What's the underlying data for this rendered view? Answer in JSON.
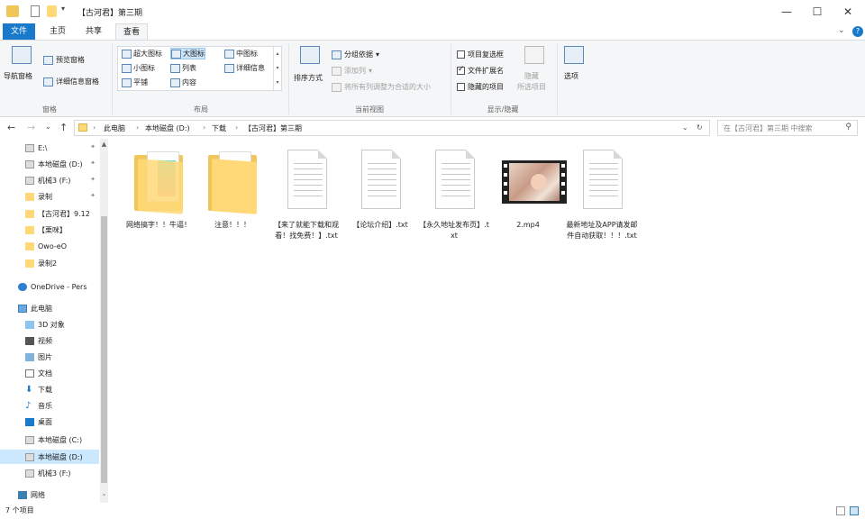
{
  "window": {
    "title": "【古河君】第三期",
    "minimize_glyph": "—",
    "maximize_glyph": "☐",
    "close_glyph": "✕",
    "help_glyph": "?",
    "collapse_glyph": "⌄"
  },
  "tabs": [
    {
      "label": "文件"
    },
    {
      "label": "主页"
    },
    {
      "label": "共享"
    },
    {
      "label": "查看"
    }
  ],
  "ribbon": {
    "panes": {
      "nav_pane": "导航窗格",
      "preview_pane": "预览窗格",
      "details_pane": "详细信息窗格",
      "group_label": "窗格"
    },
    "layout": {
      "items": [
        "超大图标",
        "大图标",
        "中图标",
        "小图标",
        "列表",
        "详细信息",
        "平铺",
        "内容"
      ],
      "selected": "大图标",
      "group_label": "布局"
    },
    "current_view": {
      "sort_by": "排序方式",
      "group_by": "分组依据",
      "add_columns": "添加列",
      "fit_columns": "将所有列调整为合适的大小",
      "group_label": "当前视图"
    },
    "show_hide": {
      "item_checkboxes": "项目复选框",
      "file_extensions": "文件扩展名",
      "hidden_items": "隐藏的项目",
      "hide_selected": "隐藏",
      "hide_selected_line2": "所选项目",
      "group_label": "显示/隐藏"
    },
    "options": {
      "label": "选项"
    }
  },
  "checkboxes": {
    "item_checkboxes": false,
    "file_extensions": true,
    "hidden_items": false
  },
  "address": {
    "back_glyph": "←",
    "forward_glyph": "→",
    "recent_glyph": "⌄",
    "up_glyph": "↑",
    "separator": "›",
    "breadcrumbs": [
      "此电脑",
      "本地磁盘 (D:)",
      "下载",
      "【古河君】第三期"
    ],
    "dropdown_glyph": "⌄",
    "refresh_glyph": "↻"
  },
  "search": {
    "placeholder": "在【古河君】第三期 中搜索",
    "icon_glyph": "⚲"
  },
  "sidebar": {
    "pin_glyph": "📌",
    "items": [
      {
        "label": "E:\\",
        "pinned": true,
        "icon": "drive-icon"
      },
      {
        "label": "本地磁盘 (D:)",
        "pinned": true,
        "icon": "drive-icon"
      },
      {
        "label": "机械3 (F:)",
        "pinned": true,
        "icon": "drive-icon"
      },
      {
        "label": "录制",
        "pinned": true,
        "icon": "folder-icon"
      },
      {
        "label": "【古河君】9.12",
        "pinned": false,
        "icon": "folder-icon"
      },
      {
        "label": "【栗咪】",
        "pinned": false,
        "icon": "folder-icon"
      },
      {
        "label": "Owo-eO",
        "pinned": false,
        "icon": "folder-icon"
      },
      {
        "label": "录制2",
        "pinned": false,
        "icon": "folder-icon"
      },
      {
        "label": "OneDrive - Pers",
        "pinned": false,
        "icon": "cloud-icon"
      },
      {
        "label": "此电脑",
        "pinned": false,
        "icon": "computer-icon"
      },
      {
        "label": "3D 对象",
        "pinned": false,
        "icon": "cube-icon"
      },
      {
        "label": "视频",
        "pinned": false,
        "icon": "video-icon"
      },
      {
        "label": "图片",
        "pinned": false,
        "icon": "picture-icon"
      },
      {
        "label": "文档",
        "pinned": false,
        "icon": "document-icon"
      },
      {
        "label": "下载",
        "pinned": false,
        "icon": "download-icon"
      },
      {
        "label": "音乐",
        "pinned": false,
        "icon": "music-icon"
      },
      {
        "label": "桌面",
        "pinned": false,
        "icon": "desktop-icon"
      },
      {
        "label": "本地磁盘 (C:)",
        "pinned": false,
        "icon": "drive-icon"
      },
      {
        "label": "本地磁盘 (D:)",
        "pinned": false,
        "icon": "drive-icon",
        "selected": true
      },
      {
        "label": "机械3 (F:)",
        "pinned": false,
        "icon": "drive-icon"
      },
      {
        "label": "网络",
        "pinned": false,
        "icon": "network-icon"
      }
    ],
    "scroll_up_glyph": "▲",
    "scroll_down_glyph": "⌄"
  },
  "files": [
    {
      "name": "网络搞字！！牛逼！",
      "type": "folder-with-content",
      "icon": "folder-icon"
    },
    {
      "name": "注意！！！",
      "type": "folder",
      "icon": "folder-icon"
    },
    {
      "name": "【来了就能下载和观看！找免费！】.txt",
      "type": "text",
      "icon": "text-file-icon"
    },
    {
      "name": "【论坛介绍】.txt",
      "type": "text",
      "icon": "text-file-icon"
    },
    {
      "name": "【永久地址发布页】.txt",
      "type": "text",
      "icon": "text-file-icon"
    },
    {
      "name": "2.mp4",
      "type": "video",
      "icon": "video-file-icon"
    },
    {
      "name": "最新地址及APP请发邮件自动获取！！！.txt",
      "type": "text",
      "icon": "text-file-icon"
    }
  ],
  "status": {
    "item_count": "7 个项目"
  },
  "colors": {
    "file_tab": "#1979ca",
    "ribbon_bg": "#f5f6f7",
    "selection": "#cce8ff",
    "folder": "#ffd978"
  }
}
